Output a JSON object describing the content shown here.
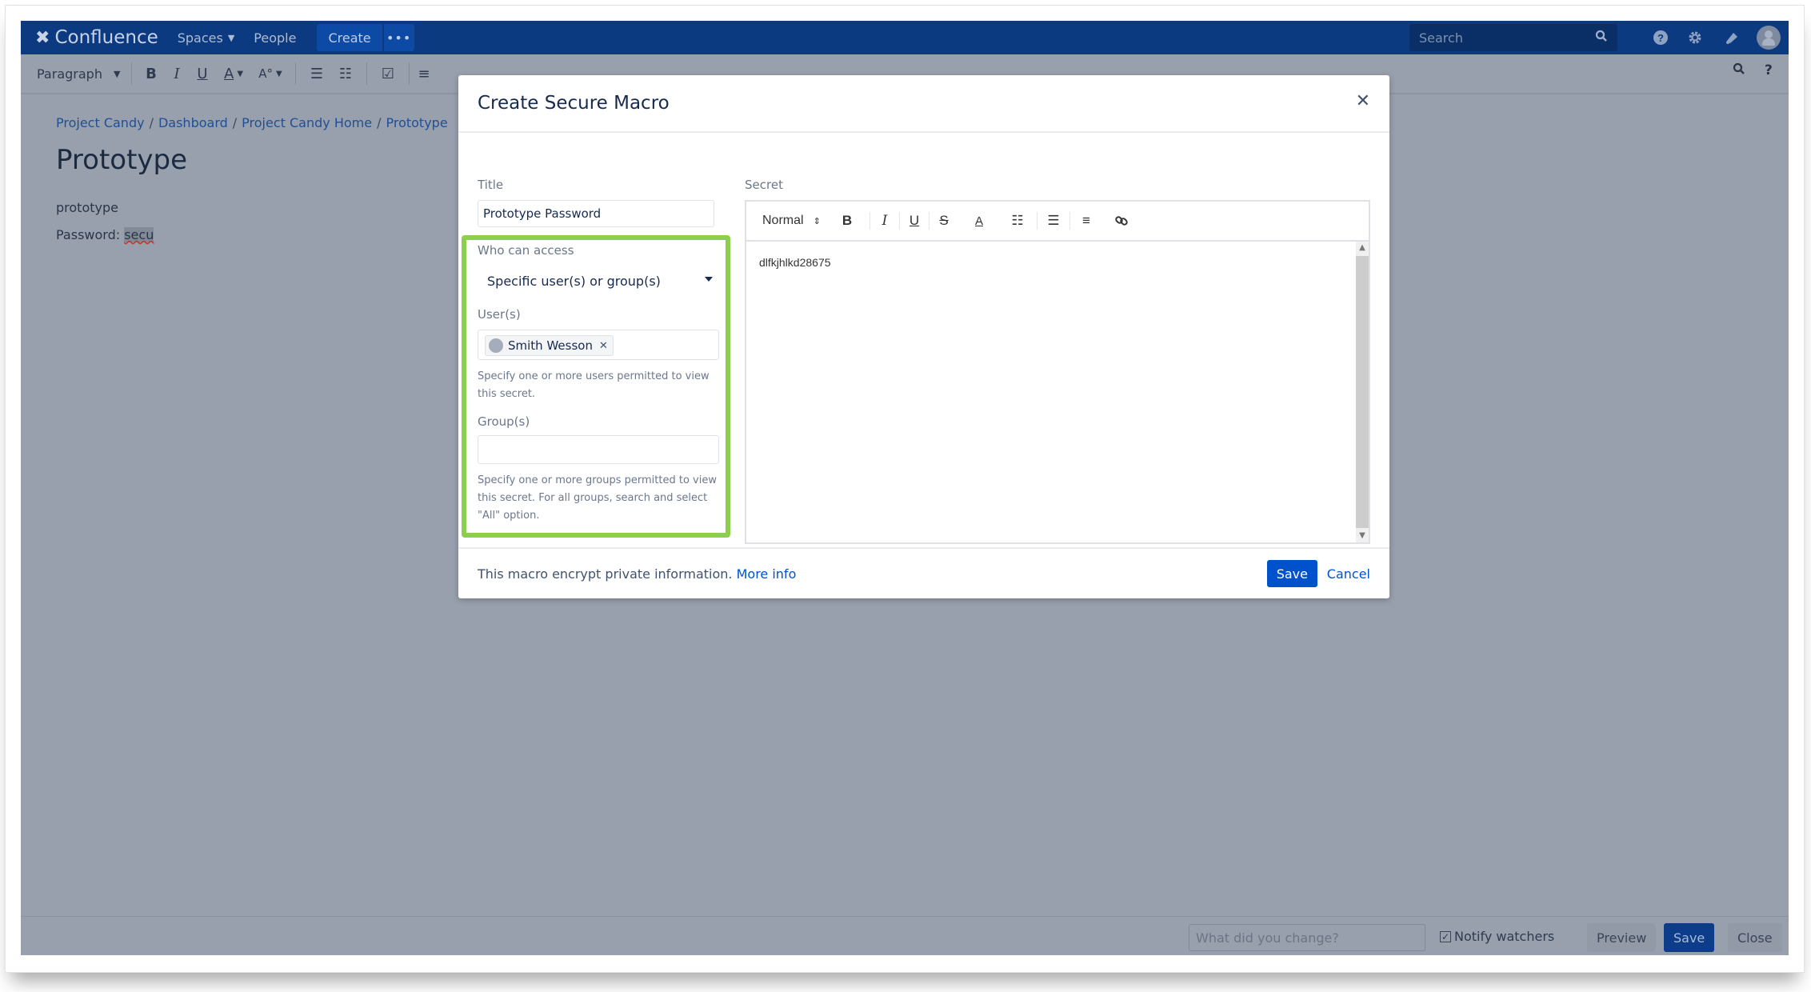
{
  "nav": {
    "brand": "Confluence",
    "spaces": "Spaces",
    "people": "People",
    "create": "Create",
    "more": "•••",
    "search_placeholder": "Search"
  },
  "toolbar": {
    "paragraph": "Paragraph",
    "bold": "B",
    "italic": "I",
    "underline": "U",
    "text_color": "A",
    "more_format": "A̰"
  },
  "page": {
    "breadcrumb": [
      "Project Candy",
      "Dashboard",
      "Project Candy Home",
      "Prototype"
    ],
    "title": "Prototype",
    "line1": "prototype",
    "line2_prefix": "Password: ",
    "line2_macro": "secu"
  },
  "modal": {
    "title": "Create Secure Macro",
    "title_label": "Title",
    "title_value": "Prototype Password",
    "who_label": "Who can access",
    "who_value": "Specific user(s) or group(s)",
    "users_label": "User(s)",
    "users": [
      "Smith Wesson"
    ],
    "users_help": "Specify one or more users permitted to view this secret.",
    "groups_label": "Group(s)",
    "groups_value": "",
    "groups_help": "Specify one or more groups permitted to view this secret. For all groups, search and select \"All\" option.",
    "secret_label": "Secret",
    "secret_format": "Normal",
    "secret_value": "dlfkjhlkd28675",
    "footer_text": "This macro encrypt private information.",
    "footer_link": "More info",
    "save": "Save",
    "cancel": "Cancel"
  },
  "bottombar": {
    "change_placeholder": "What did you change?",
    "notify_label": "Notify watchers",
    "notify_checked": true,
    "preview": "Preview",
    "save": "Save",
    "close": "Close"
  },
  "colors": {
    "nav_bg": "#0b3a80",
    "overlay_bg": "#98a0ad",
    "highlight_border": "#8ccf4d",
    "primary": "#0052cc"
  }
}
